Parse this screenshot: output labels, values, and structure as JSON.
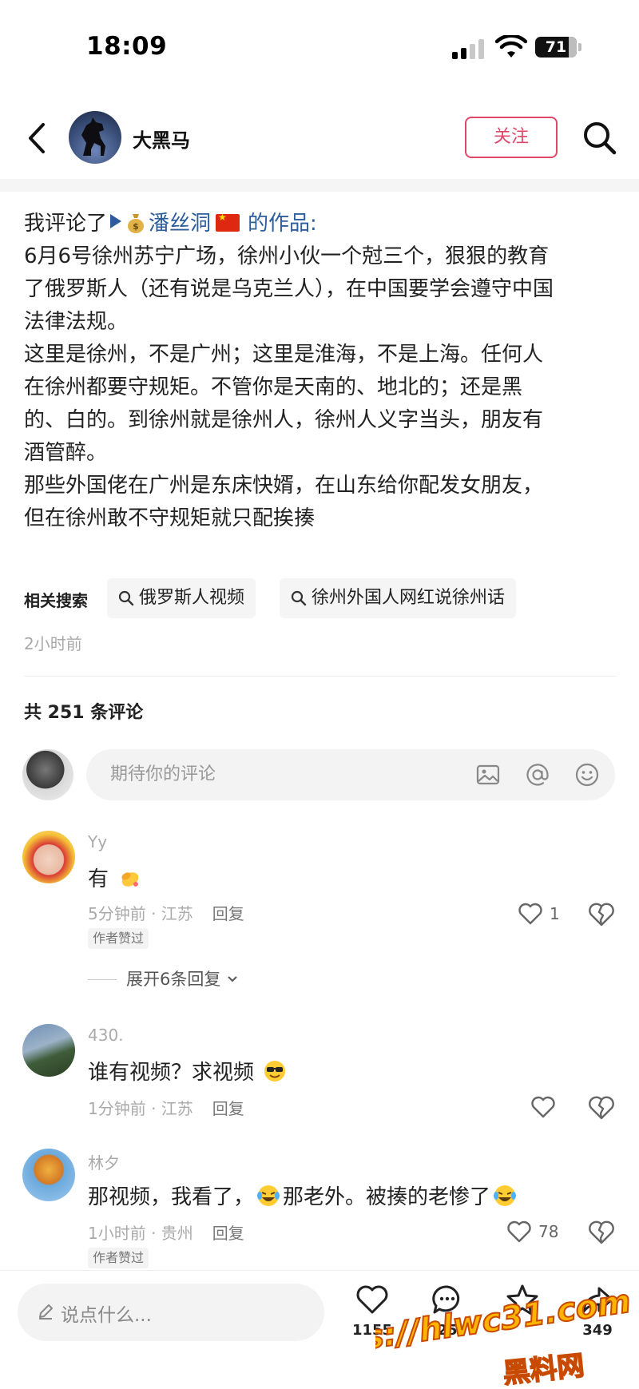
{
  "status_bar": {
    "time": "18:09",
    "battery": "71"
  },
  "header": {
    "username": "大黑马",
    "follow_label": "关注"
  },
  "post": {
    "intro_prefix": "我评论了",
    "intro_author": "潘丝洞",
    "intro_suffix": "的作品:",
    "lines": [
      "6月6号徐州苏宁广场，徐州小伙一个尅三个，狠狠的教育",
      "了俄罗斯人（还有说是乌克兰人），在中国要学会遵守中国",
      "法律法规。",
      "这里是徐州，不是广州；这里是淮海，不是上海。任何人",
      "在徐州都要守规矩。不管你是天南的、地北的；还是黑",
      "的、白的。到徐州就是徐州人，徐州人义字当头，朋友有",
      "酒管醉。",
      "那些外国佬在广州是东床快婿，在山东给你配发女朋友，",
      "但在徐州敢不守规矩就只配挨揍"
    ],
    "related_label": "相关搜索",
    "related_searches": [
      "俄罗斯人视频",
      "徐州外国人网红说徐州话"
    ],
    "time_ago": "2小时前"
  },
  "comments_section": {
    "count_label": "共 251 条评论",
    "input_placeholder": "期待你的评论"
  },
  "comments": [
    {
      "name": "Yy",
      "text": "有",
      "emoji": "clapping-hand",
      "meta": "5分钟前 · 江苏",
      "reply": "回复",
      "likes": "1",
      "author_liked": "作者赞过"
    },
    {
      "name": "430.",
      "text": "谁有视频？求视频",
      "emoji": "sunglasses-face",
      "meta": "1分钟前 · 江苏",
      "reply": "回复",
      "likes": ""
    },
    {
      "name": "林夕",
      "text_a": "那视频，我看了，",
      "text_b": "那老外。被揍的老惨了",
      "emoji": "laughing-crying-face",
      "meta": "1小时前 · 贵州",
      "reply": "回复",
      "likes": "78",
      "author_liked": "作者赞过"
    }
  ],
  "expand_replies": "展开6条回复",
  "bottom_bar": {
    "say_placeholder": "说点什么...",
    "likes": "1155",
    "comments": "25",
    "favorites": "",
    "shares": "349"
  },
  "watermark": {
    "url": "https://hlwc31.com",
    "site": "黑料网"
  }
}
